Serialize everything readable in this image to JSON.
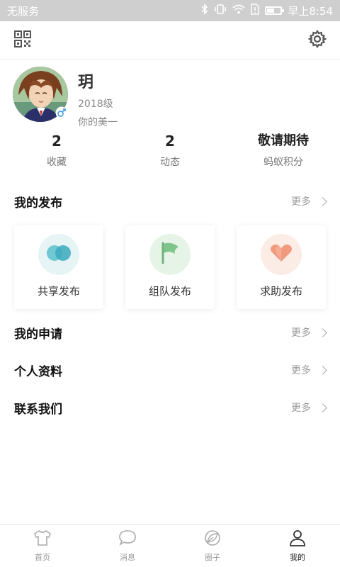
{
  "status_bar": {
    "carrier": "无服务",
    "time": "早上8:54",
    "icons": [
      "bluetooth-icon",
      "vibrate-icon",
      "wifi-icon",
      "sim-icon",
      "battery-icon"
    ],
    "battery_level": 0.55
  },
  "top_bar": {
    "left_icon": "qr-code-icon",
    "right_icon": "settings-gear-icon"
  },
  "profile": {
    "name": "玥",
    "grade": "2018级",
    "signature": "你的美一",
    "gender_icon": "male-icon"
  },
  "stats": [
    {
      "value": "2",
      "label": "收藏"
    },
    {
      "value": "2",
      "label": "动态"
    },
    {
      "value": "敬请期待",
      "label": "蚂蚁积分"
    }
  ],
  "sections": {
    "publish": {
      "title": "我的发布",
      "more": "更多"
    },
    "applications": {
      "title": "我的申请",
      "more": "更多"
    },
    "profile_info": {
      "title": "个人资料",
      "more": "更多"
    },
    "contact": {
      "title": "联系我们",
      "more": "更多"
    }
  },
  "publish_cards": [
    {
      "label": "共享发布",
      "icon": "cloud-icon",
      "color": "#5bc0cf",
      "bg": "#e6f4f6"
    },
    {
      "label": "组队发布",
      "icon": "flag-icon",
      "color": "#7fc48a",
      "bg": "#e6f4e7"
    },
    {
      "label": "求助发布",
      "icon": "heart-icon",
      "color": "#f29a7d",
      "bg": "#fbece6"
    }
  ],
  "tabs": [
    {
      "label": "首页",
      "icon": "shirt-icon",
      "active": false
    },
    {
      "label": "消息",
      "icon": "chat-bubble-icon",
      "active": false
    },
    {
      "label": "圈子",
      "icon": "leaf-icon",
      "active": false
    },
    {
      "label": "我的",
      "icon": "person-icon",
      "active": true
    }
  ]
}
